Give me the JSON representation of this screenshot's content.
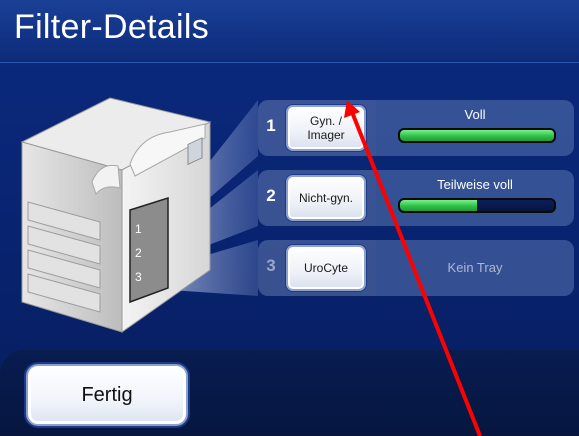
{
  "header": {
    "title": "Filter-Details"
  },
  "device": {
    "slot_labels": [
      "1",
      "2",
      "3"
    ]
  },
  "rows": [
    {
      "number": "1",
      "button_label": "Gyn. / Imager",
      "status": "Voll",
      "fill_fraction": 1.0,
      "enabled": true
    },
    {
      "number": "2",
      "button_label": "Nicht-gyn.",
      "status": "Teilweise voll",
      "fill_fraction": 0.5,
      "enabled": true
    },
    {
      "number": "3",
      "button_label": "UroCyte",
      "status": "Kein Tray",
      "fill_fraction": null,
      "enabled": false
    }
  ],
  "footer": {
    "done_label": "Fertig"
  },
  "colors": {
    "background": "#0b2a80",
    "bar_fill": "#2fc24a",
    "annotation_arrow": "#ff0000"
  }
}
